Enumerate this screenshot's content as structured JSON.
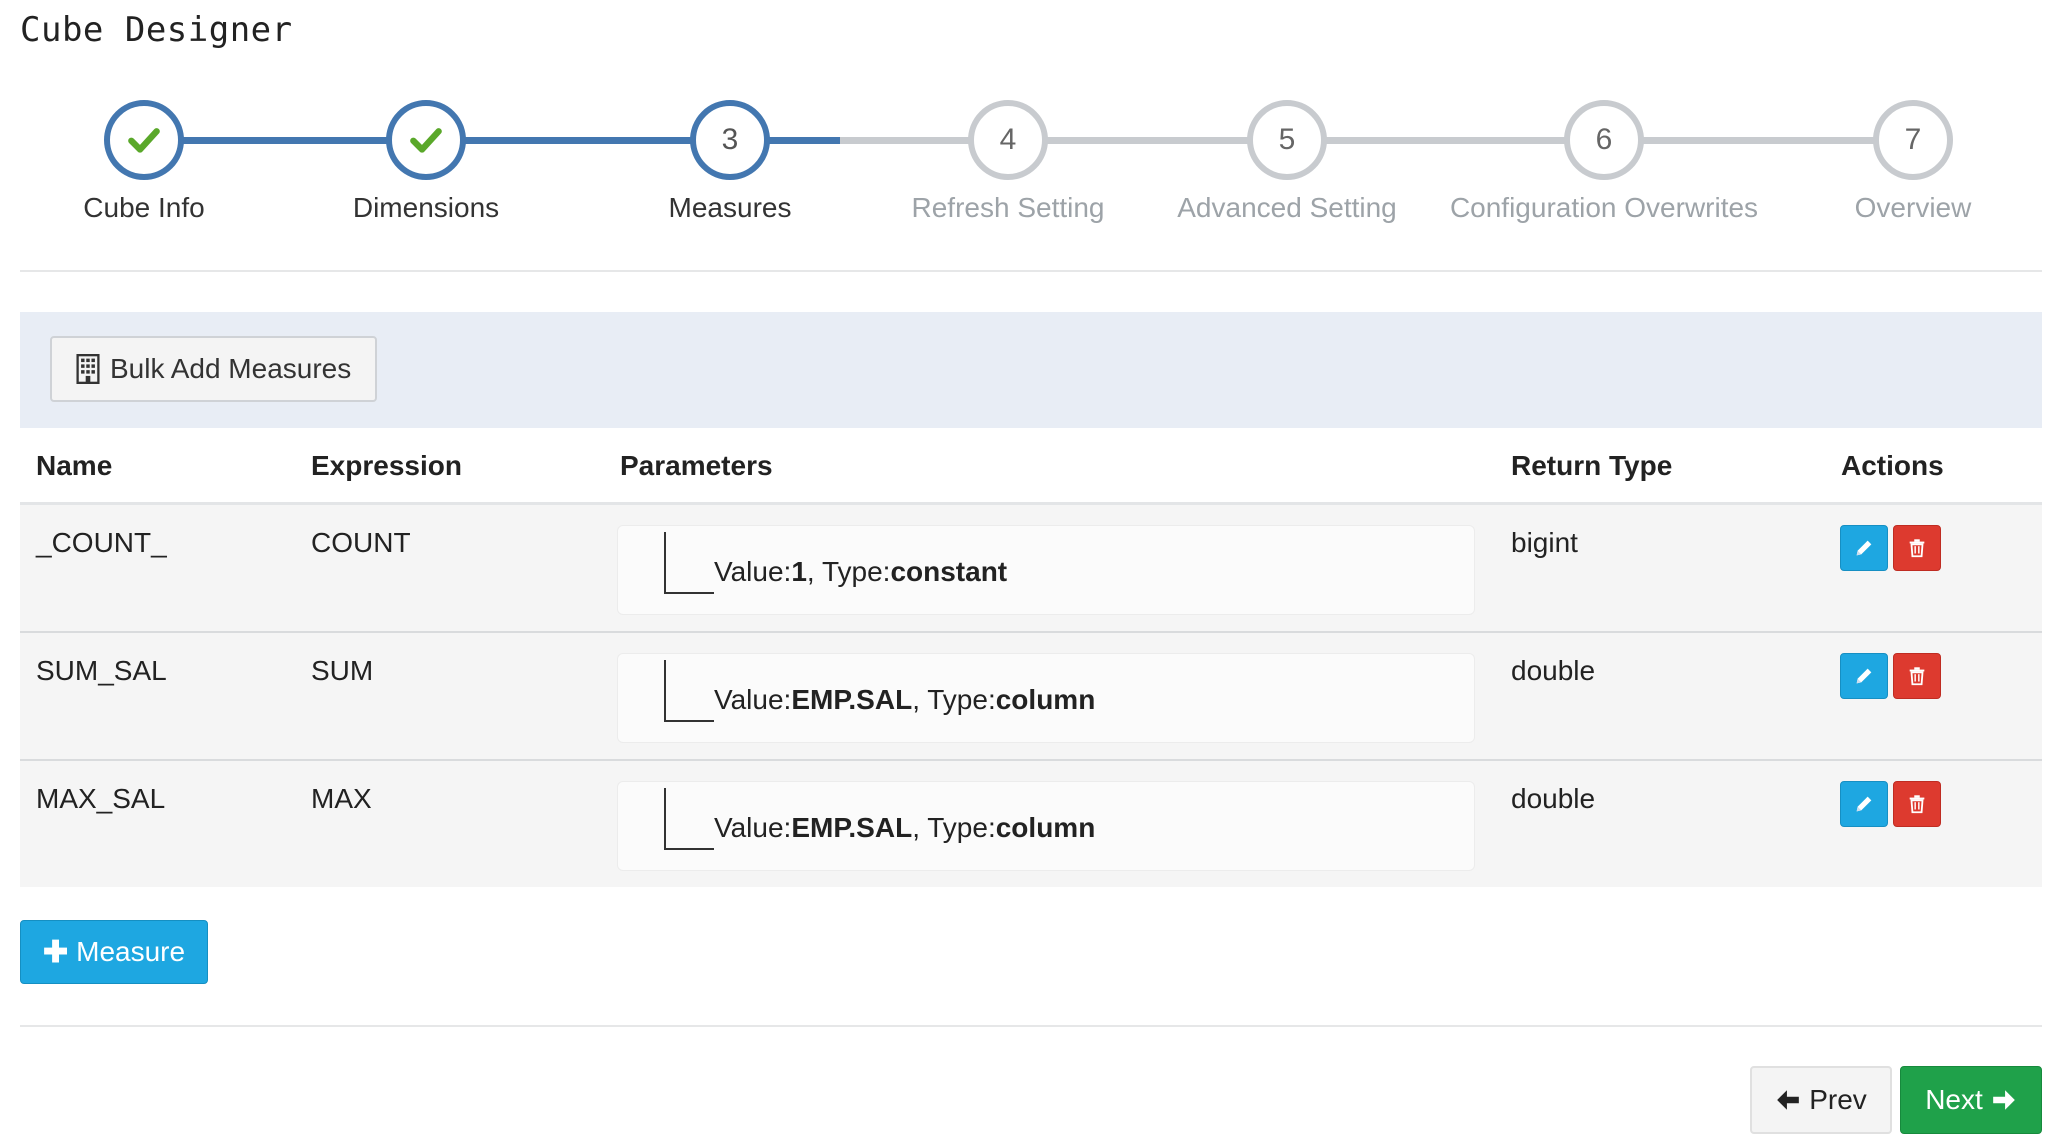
{
  "app": {
    "title": "Cube Designer"
  },
  "wizard": {
    "steps": [
      {
        "number": "1",
        "label": "Cube Info",
        "status": "completed"
      },
      {
        "number": "2",
        "label": "Dimensions",
        "status": "completed"
      },
      {
        "number": "3",
        "label": "Measures",
        "status": "current"
      },
      {
        "number": "4",
        "label": "Refresh Setting",
        "status": "todo"
      },
      {
        "number": "5",
        "label": "Advanced Setting",
        "status": "todo"
      },
      {
        "number": "6",
        "label": "Configuration Overwrites",
        "status": "todo"
      },
      {
        "number": "7",
        "label": "Overview",
        "status": "todo"
      }
    ]
  },
  "toolbar": {
    "bulk_add_label": "Bulk Add Measures"
  },
  "table": {
    "headers": {
      "name": "Name",
      "expression": "Expression",
      "parameters": "Parameters",
      "return_type": "Return Type",
      "actions": "Actions"
    },
    "rows": [
      {
        "name": "_COUNT_",
        "expression": "COUNT",
        "value_label": "Value:",
        "value": "1",
        "type_label": ", Type:",
        "type": "constant",
        "return_type": "bigint"
      },
      {
        "name": "SUM_SAL",
        "expression": "SUM",
        "value_label": "Value:",
        "value": "EMP.SAL",
        "type_label": ", Type:",
        "type": "column",
        "return_type": "double"
      },
      {
        "name": "MAX_SAL",
        "expression": "MAX",
        "value_label": "Value:",
        "value": "EMP.SAL",
        "type_label": ", Type:",
        "type": "column",
        "return_type": "double"
      }
    ]
  },
  "buttons": {
    "add_measure": "Measure",
    "prev": "Prev",
    "next": "Next"
  },
  "colors": {
    "primary_blue": "#4377b0",
    "success_green": "#1fa14a",
    "info_blue": "#1ea7e1",
    "danger_red": "#dd3a2f",
    "check_green": "#5aa82a"
  },
  "icons": {
    "completed_step": "check-icon",
    "bulk": "building-icon",
    "edit": "pencil-icon",
    "delete": "trash-icon",
    "add": "plus-icon",
    "prev": "arrow-left-icon",
    "next": "arrow-right-icon"
  }
}
